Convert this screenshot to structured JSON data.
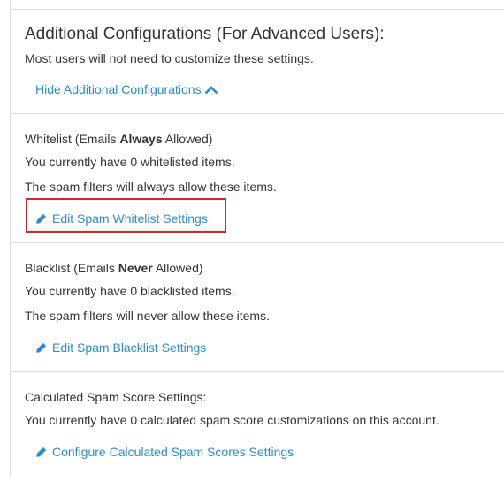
{
  "header": {
    "title": "Additional Configurations (For Advanced Users):",
    "subtitle": "Most users will not need to customize these settings.",
    "toggle_label": "Hide Additional Configurations"
  },
  "whitelist": {
    "heading_prefix": "Whitelist (Emails ",
    "heading_bold": "Always",
    "heading_suffix": " Allowed)",
    "count_text": "You currently have 0 whitelisted items.",
    "description": "The spam filters will always allow these items.",
    "edit_label": "Edit Spam Whitelist Settings"
  },
  "blacklist": {
    "heading_prefix": "Blacklist (Emails ",
    "heading_bold": "Never",
    "heading_suffix": " Allowed)",
    "count_text": "You currently have 0 blacklisted items.",
    "description": "The spam filters will never allow these items.",
    "edit_label": "Edit Spam Blacklist Settings"
  },
  "calculated": {
    "heading": "Calculated Spam Score Settings:",
    "count_text": "You currently have 0 calculated spam score customizations on this account.",
    "edit_label": "Configure Calculated Spam Scores Settings"
  },
  "colors": {
    "link": "#2a8bd4",
    "highlight": "#d9232a",
    "text": "#333333",
    "border": "#dddddd"
  },
  "icons": {
    "toggle": "chevron-up-icon",
    "edit": "pencil-icon"
  }
}
